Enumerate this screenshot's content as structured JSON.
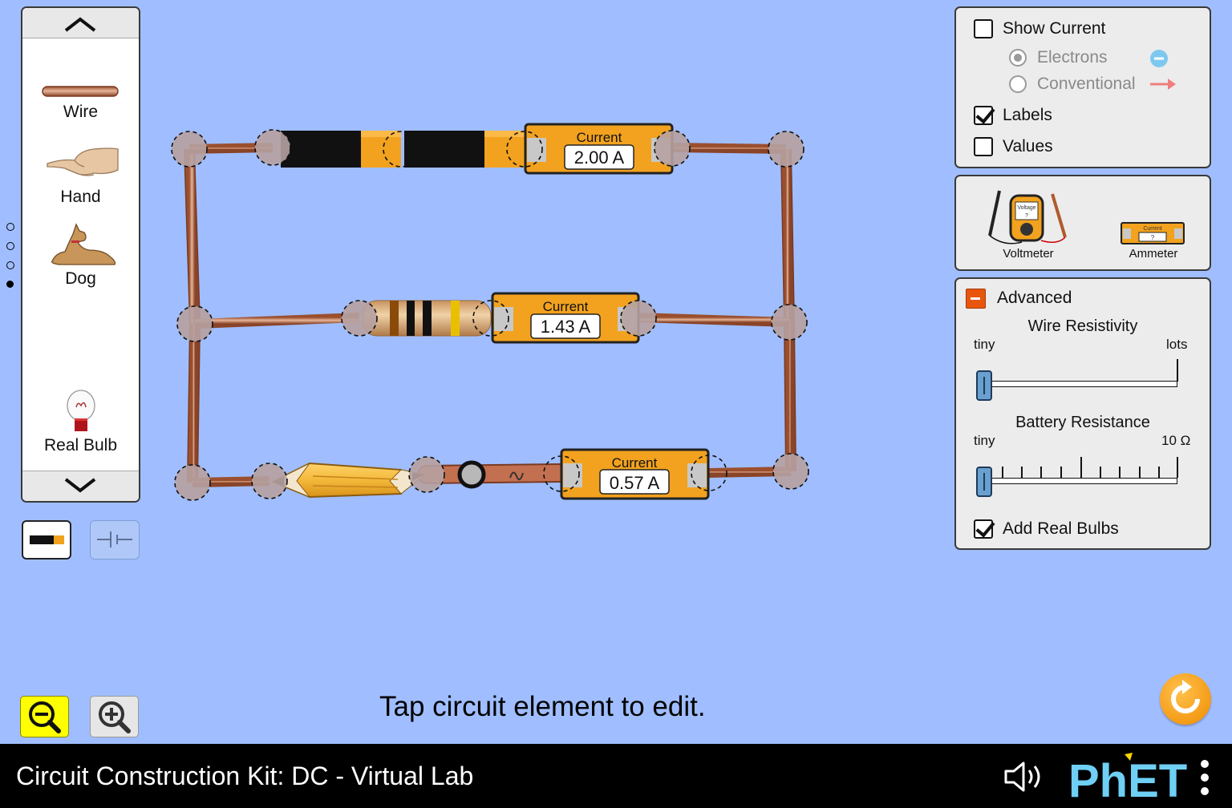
{
  "carousel": {
    "items": [
      {
        "label": "Wire",
        "icon": "wire-icon"
      },
      {
        "label": "Hand",
        "icon": "hand-icon"
      },
      {
        "label": "Dog",
        "icon": "dog-icon"
      },
      {
        "label": "Real Bulb",
        "icon": "real-bulb-icon"
      }
    ],
    "page_count": 4,
    "active_page": 4
  },
  "circuit": {
    "ammeters": [
      {
        "label": "Current",
        "value": "2.00 A"
      },
      {
        "label": "Current",
        "value": "1.43 A"
      },
      {
        "label": "Current",
        "value": "0.57 A"
      }
    ]
  },
  "display_panel": {
    "show_current": {
      "label": "Show Current",
      "checked": false
    },
    "electrons": {
      "label": "Electrons",
      "selected": true
    },
    "conventional": {
      "label": "Conventional",
      "selected": false
    },
    "labels": {
      "label": "Labels",
      "checked": true
    },
    "values": {
      "label": "Values",
      "checked": false
    }
  },
  "meters_panel": {
    "voltmeter": {
      "label": "Voltmeter",
      "screen_text": "Voltage",
      "reading": "?"
    },
    "ammeter": {
      "label": "Ammeter",
      "screen_text": "Current",
      "reading": "?"
    }
  },
  "advanced_panel": {
    "title": "Advanced",
    "wire_resistivity": {
      "title": "Wire Resistivity",
      "min_label": "tiny",
      "max_label": "lots",
      "value_fraction": 0.0
    },
    "battery_resistance": {
      "title": "Battery Resistance",
      "min_label": "tiny",
      "max_label": "10 Ω",
      "value_fraction": 0.0
    },
    "add_real_bulbs": {
      "label": "Add Real Bulbs",
      "checked": true
    }
  },
  "status_text": "Tap circuit element to edit.",
  "navbar": {
    "title": "Circuit Construction Kit: DC - Virtual Lab",
    "logo_text": "PhET"
  },
  "colors": {
    "background": "#a0beff",
    "ammeter_orange": "#f2a21e",
    "reset_orange": "#f39a0f",
    "zoom_out_yellow": "#ffff00"
  }
}
